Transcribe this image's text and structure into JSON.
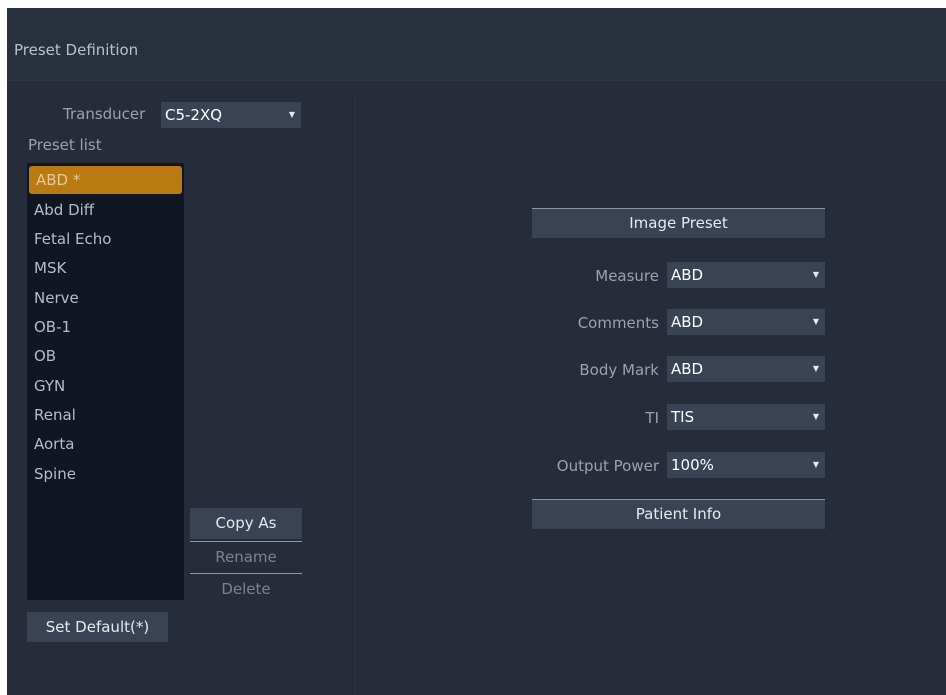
{
  "window": {
    "title": "Preset Definition"
  },
  "transducer": {
    "label": "Transducer",
    "value": "C5-2XQ"
  },
  "preset_list": {
    "label": "Preset  list",
    "selected_index": 0,
    "items": [
      {
        "label": "ABD *"
      },
      {
        "label": "Abd Diff"
      },
      {
        "label": "Fetal Echo"
      },
      {
        "label": "MSK"
      },
      {
        "label": "Nerve"
      },
      {
        "label": "OB-1"
      },
      {
        "label": "OB"
      },
      {
        "label": "GYN"
      },
      {
        "label": "Renal"
      },
      {
        "label": "Aorta"
      },
      {
        "label": "Spine"
      }
    ]
  },
  "actions": {
    "copy_as": "Copy As",
    "rename": "Rename",
    "delete": "Delete",
    "set_default": "Set Default(*)"
  },
  "image_preset": {
    "header": "Image Preset",
    "fields": [
      {
        "label": "Measure",
        "value": "ABD"
      },
      {
        "label": "Comments",
        "value": "ABD"
      },
      {
        "label": "Body Mark",
        "value": "ABD"
      },
      {
        "label": "TI",
        "value": "TIS"
      },
      {
        "label": "Output Power",
        "value": "100%"
      }
    ]
  },
  "patient_info": {
    "header": "Patient Info"
  },
  "colors": {
    "background": "#262c39",
    "selected": "#b97a11",
    "list_bg": "#111722",
    "control": "#3a4353"
  }
}
